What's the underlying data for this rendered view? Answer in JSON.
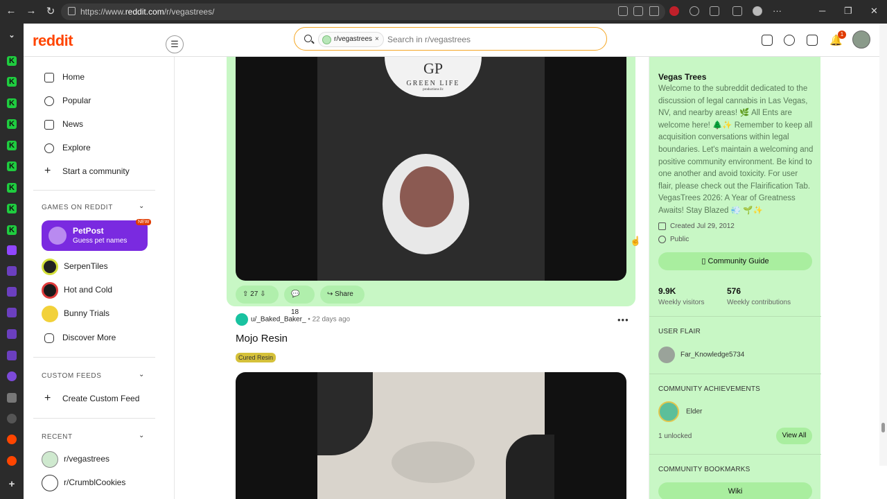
{
  "browser": {
    "url_prefix": "https://www.",
    "url_domain": "reddit.com",
    "url_path": "/r/vegastrees/"
  },
  "header": {
    "logo": "reddit",
    "search_chip": "r/vegastrees",
    "search_chip_close": "×",
    "search_placeholder": "Search in r/vegastrees",
    "notification_count": "1"
  },
  "left_nav": {
    "items": [
      {
        "label": "Home",
        "icon": "home-icon"
      },
      {
        "label": "Popular",
        "icon": "popular-icon"
      },
      {
        "label": "News",
        "icon": "news-icon"
      },
      {
        "label": "Explore",
        "icon": "explore-icon"
      },
      {
        "label": "Start a community",
        "icon": "plus-icon"
      }
    ],
    "games_header": "GAMES ON REDDIT",
    "petpost": {
      "title": "PetPost",
      "subtitle": "Guess pet names",
      "badge": "NEW"
    },
    "games": [
      "SerpenTiles",
      "Hot and Cold",
      "Bunny Trials",
      "Discover More"
    ],
    "custom_feeds_header": "CUSTOM FEEDS",
    "create_custom_feed": "Create Custom Feed",
    "recent_header": "RECENT",
    "recent": [
      "r/vegastrees",
      "r/CrumblCookies"
    ]
  },
  "post1": {
    "jar_logo_initials": "GP",
    "jar_logo_name": "GREEN LIFE",
    "jar_logo_sub": "productions llc",
    "upvotes": "27",
    "comments": "18",
    "share": "Share"
  },
  "post2": {
    "author": "u/_Baked_Baker_",
    "time": "• 22 days ago",
    "title": "Mojo Resin",
    "flair": "Cured Resin",
    "more": "•••"
  },
  "sidebar": {
    "title": "Vegas Trees",
    "description": "Welcome to the subreddit dedicated to the discussion of legal cannabis in Las Vegas, NV, and nearby areas! 🌿 All Ents are welcome here! 🌲✨ Remember to keep all acquisition conversations within legal boundaries. Let's maintain a welcoming and positive community environment. Be kind to one another and avoid toxicity. For user flair, please check out the Flairification Tab. VegasTrees 2026: A Year of Greatness Awaits! Stay Blazed 💨 🌱✨",
    "created": "Created Jul 29, 2012",
    "visibility": "Public",
    "guide_button": "Community Guide",
    "weekly_visitors": "9.9K",
    "weekly_visitors_label": "Weekly visitors",
    "weekly_contributions": "576",
    "weekly_contributions_label": "Weekly contributions",
    "user_flair_header": "USER FLAIR",
    "user_flair_name": "Far_Knowledge5734",
    "achievements_header": "COMMUNITY ACHIEVEMENTS",
    "achievement_name": "Elder",
    "unlocked": "1 unlocked",
    "view_all": "View All",
    "bookmarks_header": "COMMUNITY BOOKMARKS",
    "wiki": "Wiki"
  },
  "colors": {
    "brand": "#ff4500",
    "community_bg": "#c8f7c5",
    "button_green": "#a9ee9f",
    "petpost": "#7a2ae0"
  }
}
